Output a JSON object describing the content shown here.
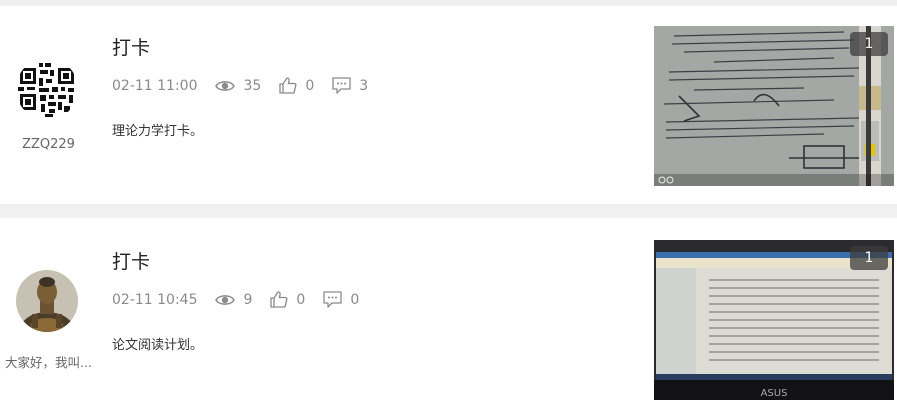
{
  "posts": [
    {
      "author": "ZZQ229",
      "avatar_icon": "qr-code-avatar",
      "title": "打卡",
      "date": "02-11 11:00",
      "views": "35",
      "likes": "0",
      "comments": "3",
      "excerpt": "理论力学打卡。",
      "image_count": "1",
      "image_icon": "textbook-photo"
    },
    {
      "author": "大家好，我叫...",
      "avatar_icon": "buddha-statue-avatar",
      "title": "打卡",
      "date": "02-11 10:45",
      "views": "9",
      "likes": "0",
      "comments": "0",
      "excerpt": "论文阅读计划。",
      "image_count": "1",
      "image_icon": "laptop-screen-photo"
    }
  ],
  "colors": {
    "page_background": "#f0f0f0",
    "card_background": "#ffffff",
    "meta_text": "#8a8a8a"
  }
}
